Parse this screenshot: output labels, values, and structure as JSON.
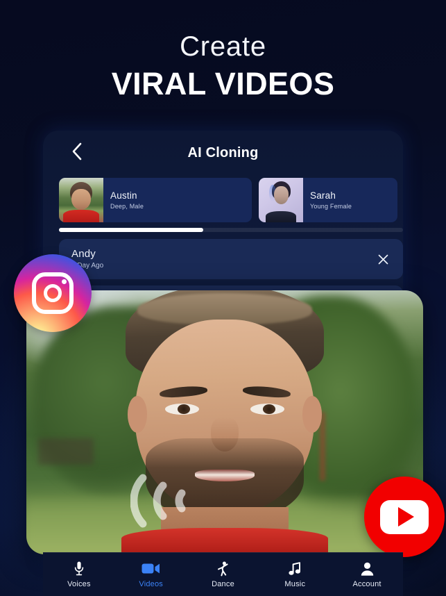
{
  "headline": {
    "line1": "Create",
    "line2": "VIRAL VIDEOS"
  },
  "app": {
    "title": "AI Cloning",
    "back_icon": "chevron-left-icon"
  },
  "voice_cards": [
    {
      "name": "Austin",
      "subtitle": "Deep, Male"
    },
    {
      "name": "Sarah",
      "subtitle": "Young Female"
    }
  ],
  "scrollbar": {
    "thumb_percent": "42%"
  },
  "history": [
    {
      "name": "Andy",
      "time": "1 Day Ago",
      "close_icon": "close-icon"
    },
    {
      "name": "",
      "time": "",
      "close_icon": "close-icon"
    }
  ],
  "video": {
    "overlay_icon": "voice-wave-icon"
  },
  "badges": {
    "instagram": "instagram-logo",
    "youtube": "youtube-logo"
  },
  "bottom_nav": {
    "active": "Videos",
    "items": [
      {
        "label": "Voices",
        "icon": "microphone-icon"
      },
      {
        "label": "Videos",
        "icon": "video-camera-icon"
      },
      {
        "label": "Dance",
        "icon": "dancer-icon"
      },
      {
        "label": "Music",
        "icon": "music-note-icon"
      },
      {
        "label": "Account",
        "icon": "person-icon"
      }
    ]
  },
  "colors": {
    "background": "#05081a",
    "panel": "#0e1a3c",
    "card": "#17285a",
    "row": "#1a2a56",
    "accent": "#3b82f6",
    "youtube_red": "#f20000"
  }
}
